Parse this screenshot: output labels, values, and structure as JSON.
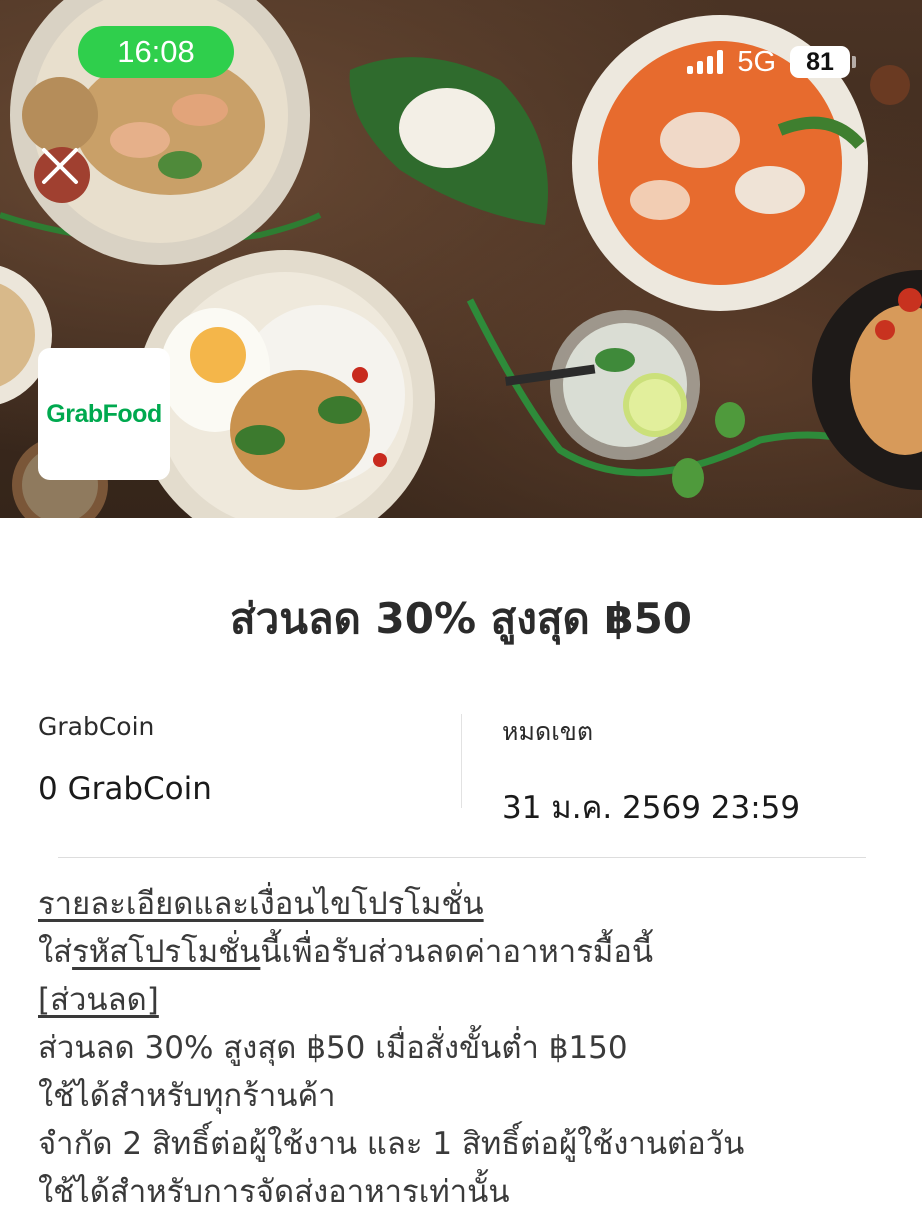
{
  "status_bar": {
    "time": "16:08",
    "network": "5G",
    "battery": "81"
  },
  "hero": {
    "logo": "GrabFood",
    "close_icon": "close-icon"
  },
  "promo": {
    "title": "ส่วนลด 30% สูงสุด ฿50"
  },
  "info": {
    "cost_label": "GrabCoin",
    "cost_value": "0 GrabCoin",
    "expiry_label": "หมดเขต",
    "expiry_value": "31 ม.ค. 2569 23:59"
  },
  "details": {
    "heading": "รายละเอียดและเงื่อนไขโปรโมชั่น",
    "line1_prefix": "ใส่",
    "line1_link": "รหัสโปรโมชั่น",
    "line1_suffix": "นี้เพื่อรับส่วนลดค่าอาหารมื้อนี้",
    "tag": "[ส่วนลด]",
    "line2": "ส่วนลด 30% สูงสุด ฿50 เมื่อสั่งขั้นต่ำ ฿150",
    "line3": "ใช้ได้สำหรับทุกร้านค้า",
    "line4": "จำกัด 2 สิทธิ์ต่อผู้ใช้งาน และ 1 สิทธิ์ต่อผู้ใช้งานต่อวัน",
    "line5": "ใช้ได้สำหรับการจัดส่งอาหารเท่านั้น"
  },
  "colors": {
    "status_pill": "#2fcf4c",
    "brand_green": "#00a94f"
  }
}
